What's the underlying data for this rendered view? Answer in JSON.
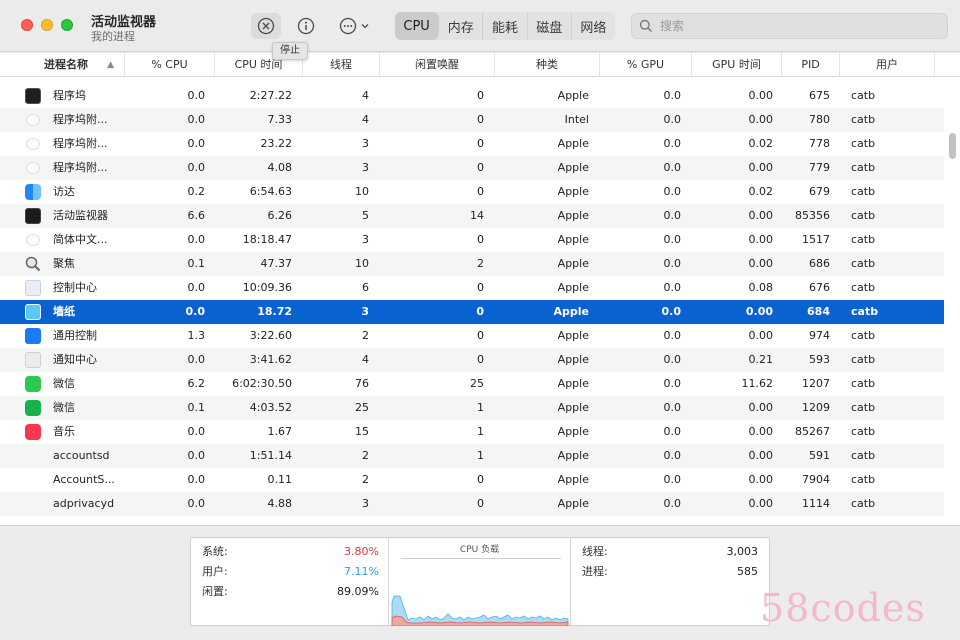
{
  "window": {
    "title": "活动监视器",
    "subtitle": "我的进程"
  },
  "toolbar": {
    "stop_tooltip": "停止",
    "tabs": [
      {
        "label": "CPU",
        "active": true
      },
      {
        "label": "内存",
        "active": false
      },
      {
        "label": "能耗",
        "active": false
      },
      {
        "label": "磁盘",
        "active": false
      },
      {
        "label": "网络",
        "active": false
      }
    ],
    "search_placeholder": "搜索",
    "icons": {
      "stop": "xmark-circle-icon",
      "info": "info-circle-icon",
      "more": "ellipsis-circle-icon",
      "search": "magnifier-icon"
    }
  },
  "table": {
    "columns": [
      "进程名称",
      "% CPU",
      "CPU 时间",
      "线程",
      "闲置唤醒",
      "种类",
      "% GPU",
      "GPU 时间",
      "PID",
      "用户"
    ],
    "rows": [
      {
        "name": "程序坞",
        "icon": "terminal",
        "cpu": "0.0",
        "cpu_time": "2:27.22",
        "threads": "4",
        "idle_wakeups": "0",
        "kind": "Apple",
        "gpu": "0.0",
        "gpu_time": "0.00",
        "pid": "675",
        "user": "catb"
      },
      {
        "name": "程序坞附...",
        "icon": "doc",
        "cpu": "0.0",
        "cpu_time": "7.33",
        "threads": "4",
        "idle_wakeups": "0",
        "kind": "Intel",
        "gpu": "0.0",
        "gpu_time": "0.00",
        "pid": "780",
        "user": "catb"
      },
      {
        "name": "程序坞附...",
        "icon": "doc",
        "cpu": "0.0",
        "cpu_time": "23.22",
        "threads": "3",
        "idle_wakeups": "0",
        "kind": "Apple",
        "gpu": "0.0",
        "gpu_time": "0.02",
        "pid": "778",
        "user": "catb"
      },
      {
        "name": "程序坞附...",
        "icon": "doc",
        "cpu": "0.0",
        "cpu_time": "4.08",
        "threads": "3",
        "idle_wakeups": "0",
        "kind": "Apple",
        "gpu": "0.0",
        "gpu_time": "0.00",
        "pid": "779",
        "user": "catb"
      },
      {
        "name": "访达",
        "icon": "finder",
        "cpu": "0.2",
        "cpu_time": "6:54.63",
        "threads": "10",
        "idle_wakeups": "0",
        "kind": "Apple",
        "gpu": "0.0",
        "gpu_time": "0.02",
        "pid": "679",
        "user": "catb"
      },
      {
        "name": "活动监视器",
        "icon": "activity",
        "cpu": "6.6",
        "cpu_time": "6.26",
        "threads": "5",
        "idle_wakeups": "14",
        "kind": "Apple",
        "gpu": "0.0",
        "gpu_time": "0.00",
        "pid": "85356",
        "user": "catb"
      },
      {
        "name": "简体中文...",
        "icon": "doc",
        "cpu": "0.0",
        "cpu_time": "18:18.47",
        "threads": "3",
        "idle_wakeups": "0",
        "kind": "Apple",
        "gpu": "0.0",
        "gpu_time": "0.00",
        "pid": "1517",
        "user": "catb"
      },
      {
        "name": "聚焦",
        "icon": "search",
        "cpu": "0.1",
        "cpu_time": "47.37",
        "threads": "10",
        "idle_wakeups": "2",
        "kind": "Apple",
        "gpu": "0.0",
        "gpu_time": "0.00",
        "pid": "686",
        "user": "catb"
      },
      {
        "name": "控制中心",
        "icon": "control",
        "cpu": "0.0",
        "cpu_time": "10:09.36",
        "threads": "6",
        "idle_wakeups": "0",
        "kind": "Apple",
        "gpu": "0.0",
        "gpu_time": "0.08",
        "pid": "676",
        "user": "catb"
      },
      {
        "name": "墙纸",
        "icon": "wallpaper",
        "cpu": "0.0",
        "cpu_time": "18.72",
        "threads": "3",
        "idle_wakeups": "0",
        "kind": "Apple",
        "gpu": "0.0",
        "gpu_time": "0.00",
        "pid": "684",
        "user": "catb",
        "selected": true
      },
      {
        "name": "通用控制",
        "icon": "universal",
        "cpu": "1.3",
        "cpu_time": "3:22.60",
        "threads": "2",
        "idle_wakeups": "0",
        "kind": "Apple",
        "gpu": "0.0",
        "gpu_time": "0.00",
        "pid": "974",
        "user": "catb"
      },
      {
        "name": "通知中心",
        "icon": "notify",
        "cpu": "0.0",
        "cpu_time": "3:41.62",
        "threads": "4",
        "idle_wakeups": "0",
        "kind": "Apple",
        "gpu": "0.0",
        "gpu_time": "0.21",
        "pid": "593",
        "user": "catb"
      },
      {
        "name": "微信",
        "icon": "wechat",
        "cpu": "6.2",
        "cpu_time": "6:02:30.50",
        "threads": "76",
        "idle_wakeups": "25",
        "kind": "Apple",
        "gpu": "0.0",
        "gpu_time": "11.62",
        "pid": "1207",
        "user": "catb"
      },
      {
        "name": "微信",
        "icon": "wecom",
        "cpu": "0.1",
        "cpu_time": "4:03.52",
        "threads": "25",
        "idle_wakeups": "1",
        "kind": "Apple",
        "gpu": "0.0",
        "gpu_time": "0.00",
        "pid": "1209",
        "user": "catb"
      },
      {
        "name": "音乐",
        "icon": "music",
        "cpu": "0.0",
        "cpu_time": "1.67",
        "threads": "15",
        "idle_wakeups": "1",
        "kind": "Apple",
        "gpu": "0.0",
        "gpu_time": "0.00",
        "pid": "85267",
        "user": "catb"
      },
      {
        "name": "accountsd",
        "icon": "none",
        "cpu": "0.0",
        "cpu_time": "1:51.14",
        "threads": "2",
        "idle_wakeups": "1",
        "kind": "Apple",
        "gpu": "0.0",
        "gpu_time": "0.00",
        "pid": "591",
        "user": "catb"
      },
      {
        "name": "AccountS...",
        "icon": "none",
        "cpu": "0.0",
        "cpu_time": "0.11",
        "threads": "2",
        "idle_wakeups": "0",
        "kind": "Apple",
        "gpu": "0.0",
        "gpu_time": "0.00",
        "pid": "7904",
        "user": "catb"
      },
      {
        "name": "adprivacyd",
        "icon": "none",
        "cpu": "0.0",
        "cpu_time": "4.88",
        "threads": "3",
        "idle_wakeups": "0",
        "kind": "Apple",
        "gpu": "0.0",
        "gpu_time": "0.00",
        "pid": "1114",
        "user": "catb"
      }
    ]
  },
  "stats": {
    "system_label": "系统:",
    "system_value": "3.80%",
    "user_label": "用户:",
    "user_value": "7.11%",
    "idle_label": "闲置:",
    "idle_value": "89.09%",
    "graph_title": "CPU 负载",
    "threads_label": "线程:",
    "threads_value": "3,003",
    "processes_label": "进程:",
    "processes_value": "585",
    "colors": {
      "system": "#d03b3b",
      "user": "#2a9fd6",
      "graph_user": "#9fd6f5",
      "graph_system": "#e88888"
    }
  },
  "watermark": "58codes"
}
